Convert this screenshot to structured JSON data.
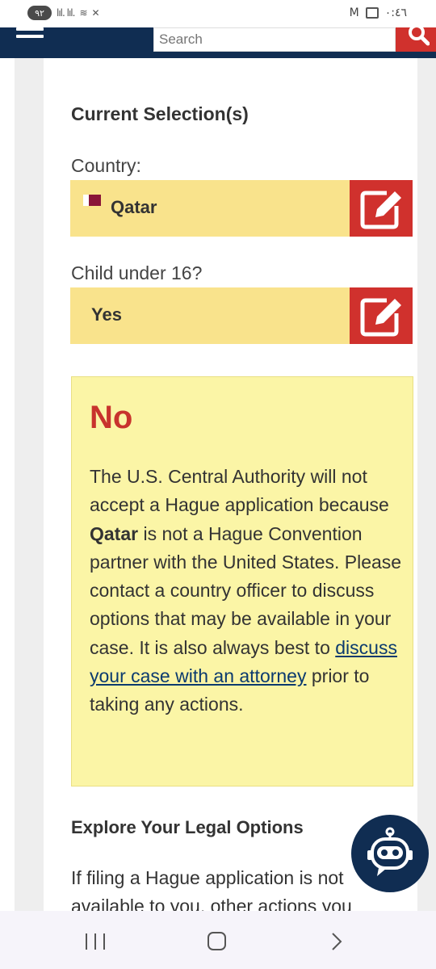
{
  "status_bar": {
    "battery": "٩٢",
    "signal": "lıl. lıl.",
    "time": "٠:٤٦"
  },
  "header": {
    "menu_icon": "hamburger-icon",
    "search_placeholder": "Search",
    "search_icon": "search-icon"
  },
  "selections": {
    "title": "Current Selection(s)",
    "country_label": "Country:",
    "country_value": "Qatar",
    "child_label": "Child under 16?",
    "child_value": "Yes",
    "edit_icon": "edit-icon"
  },
  "result": {
    "title": "No",
    "text_1": "The U.S. Central Authority will not accept a Hague application because ",
    "text_country": "Qatar",
    "text_2": " is not a Hague Convention partner with the United States. Please contact a country officer to discuss options that may be available in your case. It is also always best to ",
    "link_text": "discuss your case with an attorney",
    "text_3": " prior to taking any actions."
  },
  "explore": {
    "title": "Explore Your Legal Options",
    "text": "If filing a Hague application is not available to you, other actions you"
  },
  "colors": {
    "header_bg": "#102d52",
    "accent_red": "#d0312d",
    "selection_bg": "#f9e38c",
    "result_bg": "#fbf5a6"
  }
}
